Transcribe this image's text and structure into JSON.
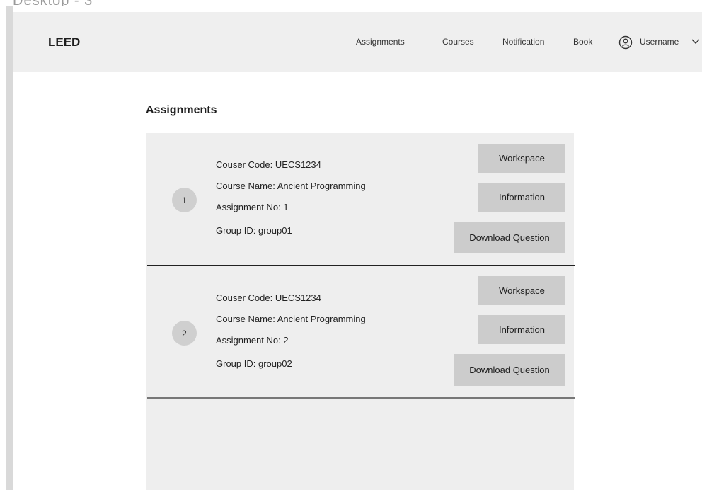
{
  "header": {
    "logo": "LEED",
    "nav": {
      "assignments": "Assignments",
      "courses": "Courses",
      "notification": "Notification",
      "book": "Book"
    },
    "user": {
      "name": "Username",
      "icon": "user-circle-icon",
      "dropdown_icon": "chevron-down-icon"
    }
  },
  "main": {
    "title": "Assignments",
    "assignments": [
      {
        "number": "1",
        "course_code": "Couser Code: UECS1234",
        "course_name": "Course Name: Ancient Programming",
        "assignment_no": "Assignment No: 1",
        "group_id": "Group ID: group01",
        "buttons": {
          "workspace": "Workspace",
          "information": "Information",
          "download": "Download Question"
        }
      },
      {
        "number": "2",
        "course_code": "Couser Code: UECS1234",
        "course_name": "Course Name: Ancient Programming",
        "assignment_no": "Assignment No: 2",
        "group_id": "Group ID: group02",
        "buttons": {
          "workspace": "Workspace",
          "information": "Information",
          "download": "Download Question"
        }
      }
    ]
  },
  "colors": {
    "header_bg": "#efefef",
    "panel_bg": "#eeeeee",
    "button_bg": "#cccccc",
    "badge_bg": "#cfcfcf",
    "text": "#1e1e1e"
  }
}
